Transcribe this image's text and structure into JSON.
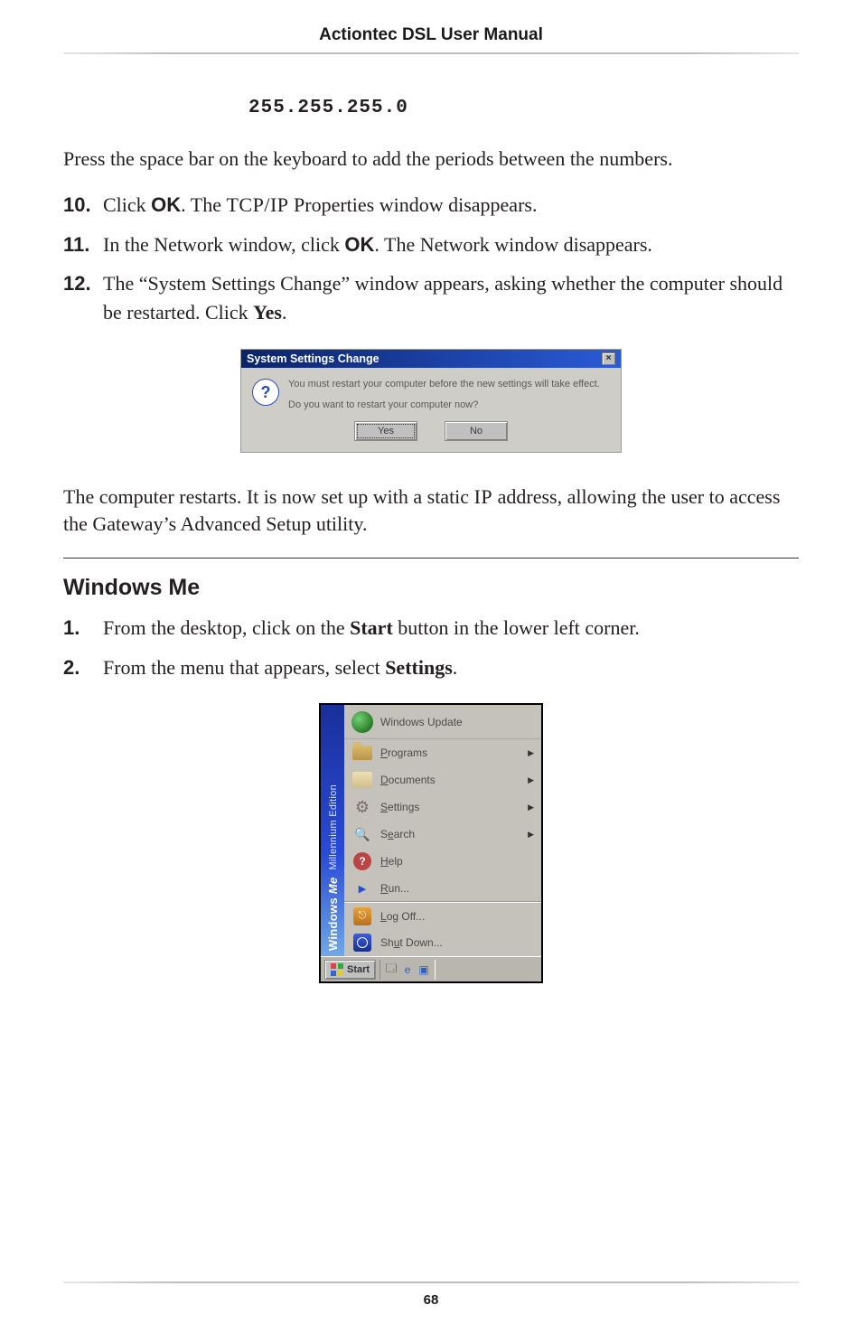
{
  "header": {
    "title": "Actiontec DSL User Manual"
  },
  "subnet": "255.255.255.0",
  "intro_para": "Press the space bar on the keyboard to add the periods between the numbers.",
  "steps_a": [
    {
      "num": "10.",
      "pre": "Click ",
      "bold": "OK",
      "post1": ". The ",
      "sc": "TCP/IP",
      "post2": " Properties window disappears."
    },
    {
      "num": "11.",
      "pre": "In the Network window, click ",
      "bold": "OK",
      "post1": ". The Network window disappears."
    },
    {
      "num": "12.",
      "pre": "The “System Settings Change” window appears, asking whether the computer should be restarted. Click ",
      "bold": "Yes",
      "post1": "."
    }
  ],
  "dialog": {
    "title": "System Settings Change",
    "line1": "You must restart your computer before the new settings will take effect.",
    "line2": "Do you want to restart your computer now?",
    "yes": "Yes",
    "no": "No"
  },
  "outro_para_pre": "The computer restarts. It is now set up with a static ",
  "outro_sc": "IP",
  "outro_para_post": " address, allowing the user to access the Gateway’s Advanced Setup utility.",
  "section_heading": "Windows Me",
  "steps_b": [
    {
      "num": "1.",
      "pre": "From the desktop, click on the ",
      "bold": "Start",
      "post1": " button in the lower left corner."
    },
    {
      "num": "2.",
      "pre": "From the menu that appears, select ",
      "bold": "Settings",
      "post1": "."
    }
  ],
  "start_menu": {
    "sidebar": {
      "windows": "Windows",
      "me": "Me",
      "edition": "Millennium Edition"
    },
    "items": {
      "windows_update": "Windows Update",
      "programs": "Programs",
      "documents": "Documents",
      "settings": "Settings",
      "search": "Search",
      "help": "Help",
      "run": "Run...",
      "logoff": "Log Off...",
      "shutdown": "Shut Down..."
    },
    "taskbar": {
      "start": "Start"
    }
  },
  "page_number": "68"
}
